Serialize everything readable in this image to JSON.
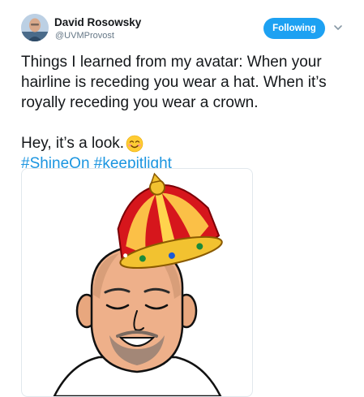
{
  "author": {
    "name": "David Rosowsky",
    "handle": "@UVMProvost",
    "avatar_icon": "profile-photo"
  },
  "follow_button": {
    "label": "Following",
    "color": "#1da1f2"
  },
  "menu_caret_icon": "chevron-down-icon",
  "tweet": {
    "lines": [
      "Things I learned from my avatar: When your",
      "hairline is receding you wear a hat. When it’s",
      "royally receding you wear a crown."
    ],
    "line2": "Hey, it’s a look.",
    "emoji": "smiling-face-with-smiling-eyes",
    "hashtags": [
      "#ShineOn",
      "#keepitlight"
    ],
    "hashtag_color": "#1b95e0"
  },
  "media": {
    "description_icon": "bitmoji-avatar-with-crown"
  }
}
